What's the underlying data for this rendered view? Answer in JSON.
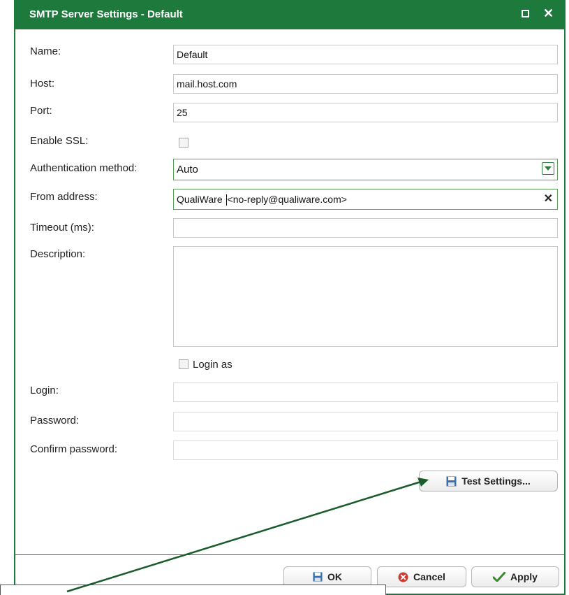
{
  "window": {
    "title": "SMTP Server Settings - Default"
  },
  "form": {
    "name_label": "Name:",
    "name_value": "Default",
    "host_label": "Host:",
    "host_value": "mail.host.com",
    "port_label": "Port:",
    "port_value": "25",
    "ssl_label": "Enable SSL:",
    "auth_label": "Authentication method:",
    "auth_value": "Auto",
    "from_label": "From address:",
    "from_value_before": "QualiWare ",
    "from_value_after": "<no-reply@qualiware.com>",
    "timeout_label": "Timeout (ms):",
    "timeout_value": "",
    "description_label": "Description:",
    "login_as_label": "Login as",
    "login_label": "Login:",
    "password_label": "Password:",
    "confirm_label": "Confirm password:"
  },
  "buttons": {
    "test_settings": "Test Settings...",
    "ok": "OK",
    "cancel": "Cancel",
    "apply": "Apply"
  },
  "colors": {
    "accent": "#1e7a3c",
    "cancel_red": "#d9372c",
    "apply_green": "#3a8a2e",
    "save_blue": "#3a6fb0"
  }
}
